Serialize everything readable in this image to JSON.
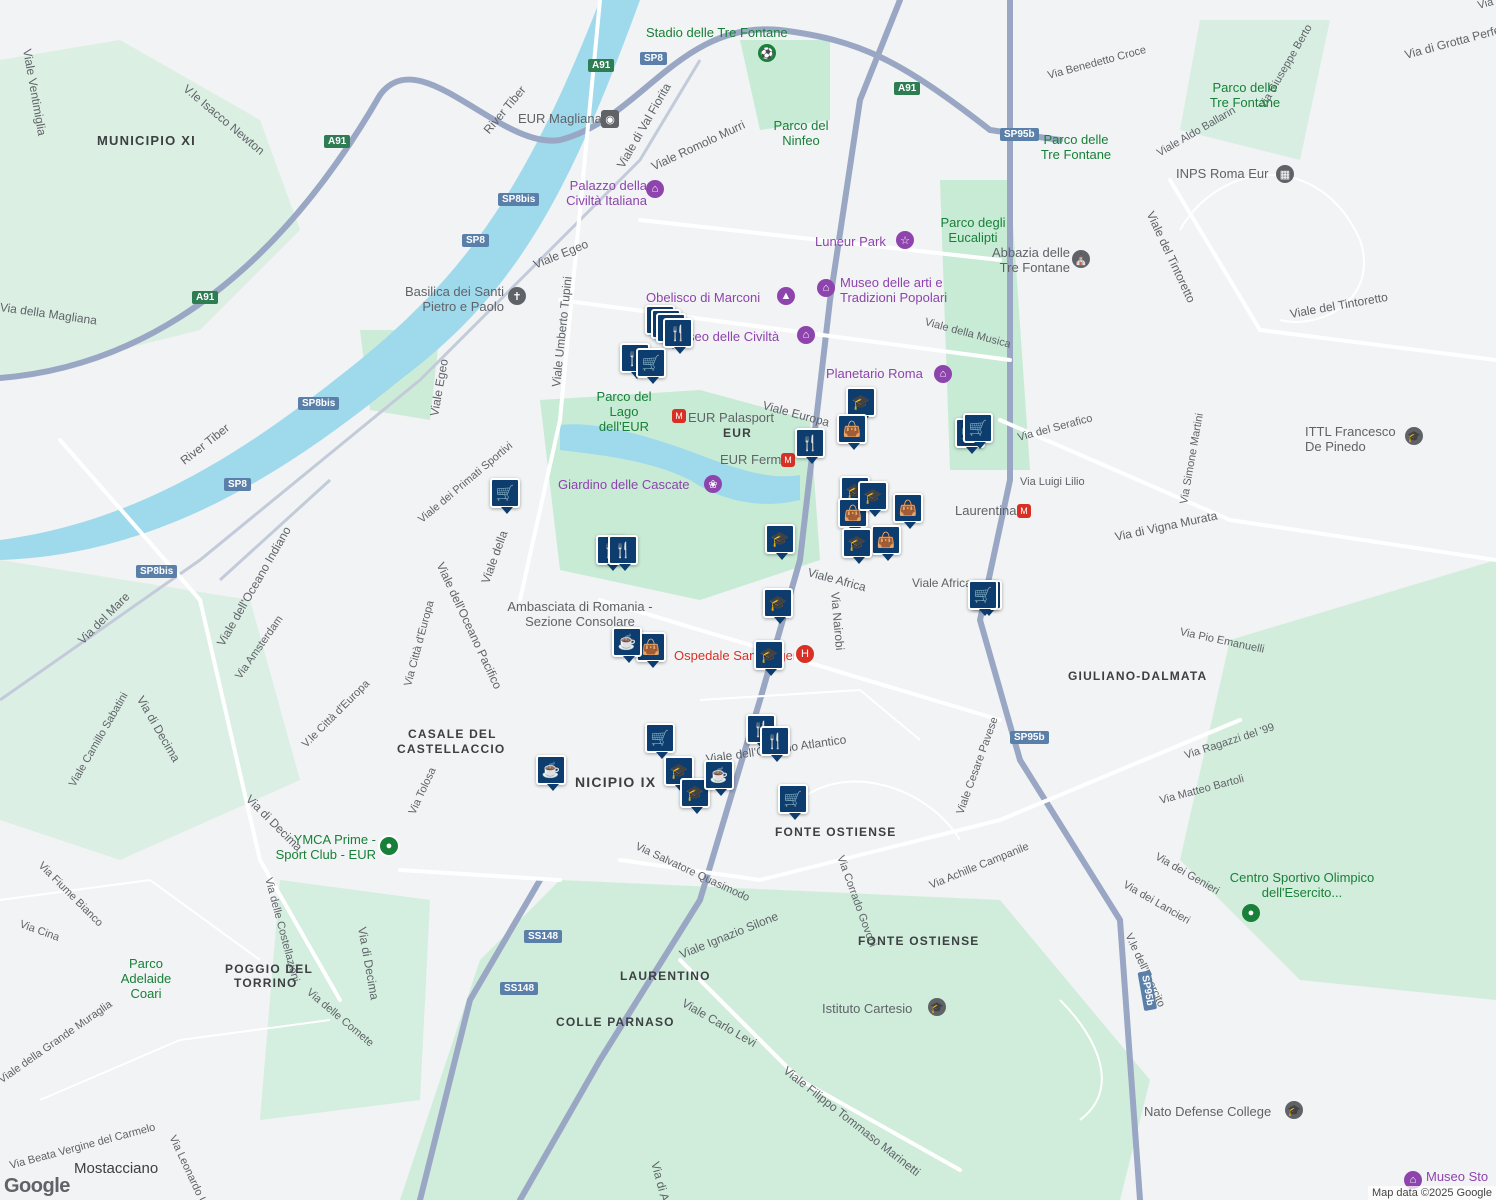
{
  "map": {
    "attribution": "Map data ©2025 Google",
    "logo": "Google",
    "colors": {
      "land": "#f1f3f4",
      "park": "#c8ebd5",
      "water": "#9fd9ec",
      "highway": "#9aa7c4",
      "road": "#ffffff",
      "pin": "#0d3d6e"
    }
  },
  "districts": [
    {
      "text": "MUNICIPIO XI"
    },
    {
      "text": "EUR"
    },
    {
      "text": "GIULIANO-DALMATA"
    },
    {
      "text": "CASALE DEL"
    },
    {
      "text": "CASTELLACCIO"
    },
    {
      "text": "NICIPIO IX"
    },
    {
      "text": "FONTE OSTIENSE"
    },
    {
      "text": "FONTE OSTIENSE"
    },
    {
      "text": "LAURENTINO"
    },
    {
      "text": "COLLE PARNASO"
    },
    {
      "text": "POGGIO DEL"
    },
    {
      "text": "TORRINO"
    },
    {
      "text": "Mostacciano"
    }
  ],
  "roads": [
    {
      "text": "Viale Ventimiglia"
    },
    {
      "text": "V.le Isacco Newton"
    },
    {
      "text": "Via della Magliana"
    },
    {
      "text": "Via del Mare"
    },
    {
      "text": "River Tiber"
    },
    {
      "text": "River Tiber"
    },
    {
      "text": "Viale Egeo"
    },
    {
      "text": "Viale Egeo"
    },
    {
      "text": "Viale Umberto Tupini"
    },
    {
      "text": "Viale di Val Fiorita"
    },
    {
      "text": "Viale Romolo Murri"
    },
    {
      "text": "Viale Europa"
    },
    {
      "text": "Viale Africa"
    },
    {
      "text": "Viale Africa"
    },
    {
      "text": "Via Nairobi"
    },
    {
      "text": "Viale dei Primati Sportivi"
    },
    {
      "text": "Viale dell'Oceano Indiano"
    },
    {
      "text": "Viale dell'Oceano Pacifico"
    },
    {
      "text": "Viale della"
    },
    {
      "text": "Via di Decima"
    },
    {
      "text": "Via di Decima"
    },
    {
      "text": "Via di Decima"
    },
    {
      "text": "Viale del Tintoretto"
    },
    {
      "text": "Viale del Tintoretto"
    },
    {
      "text": "Via di Vigna Murata"
    },
    {
      "text": "Via del Serafico"
    },
    {
      "text": "Via Luigi Lilio"
    },
    {
      "text": "Viale della Musica"
    },
    {
      "text": "Via Benedetto Croce"
    },
    {
      "text": "Via Giuseppe Berto"
    },
    {
      "text": "Viale Aldo Ballarin"
    },
    {
      "text": "Via di Grotta Perfetta"
    },
    {
      "text": "Via Pio Emanuelli"
    },
    {
      "text": "Via Ragazzi del '99"
    },
    {
      "text": "Via Matteo Bartoli"
    },
    {
      "text": "Via dei Genieri"
    },
    {
      "text": "Via dei Lancieri"
    },
    {
      "text": "V.le dell'Esercito"
    },
    {
      "text": "Viale Cesare Pavese"
    },
    {
      "text": "Via Achille Campanile"
    },
    {
      "text": "Via Corrado Govoni"
    },
    {
      "text": "Via Salvatore Quasimodo"
    },
    {
      "text": "Viale Ignazio Silone"
    },
    {
      "text": "Viale Carlo Levi"
    },
    {
      "text": "Viale Filippo Tommaso Marinetti"
    },
    {
      "text": "Via di Acilia"
    },
    {
      "text": "Via Cina"
    },
    {
      "text": "Via Fiume Bianco"
    },
    {
      "text": "Viale Camillo Sabatini"
    },
    {
      "text": "Via Amsterdam"
    },
    {
      "text": "Via Città d'Europa"
    },
    {
      "text": "V.le Città d'Europa"
    },
    {
      "text": "Via Tolosa"
    },
    {
      "text": "Via delle Costellazioni"
    },
    {
      "text": "Via delle Comete"
    },
    {
      "text": "Viale della Grande Muraglia"
    },
    {
      "text": "Via Beata Vergine del Carmelo"
    },
    {
      "text": "Via Leonardo Umile"
    },
    {
      "text": "Via Simone Martini"
    },
    {
      "text": "Via Greve"
    },
    {
      "text": "Viale dell'Oceano Atlantico"
    }
  ],
  "pois": [
    {
      "text": "Stadio delle Tre Fontane",
      "icon": "stadium-icon"
    },
    {
      "text": "EUR Magliana",
      "icon": "metro-icon"
    },
    {
      "text": "Palazzo della Civiltà Italiana",
      "icon": "museum-icon"
    },
    {
      "text": "Parco del Ninfeo",
      "icon": ""
    },
    {
      "text": "Luneur Park",
      "icon": "amusement-park-icon"
    },
    {
      "text": "Parco degli Eucalipti",
      "icon": ""
    },
    {
      "text": "Abbazia delle Tre Fontane",
      "icon": "church-icon"
    },
    {
      "text": "Parco delle Tre Fontane",
      "icon": ""
    },
    {
      "text": "Parco delle Tre Fontane",
      "icon": ""
    },
    {
      "text": "INPS Roma Eur",
      "icon": "building-icon"
    },
    {
      "text": "Museo delle arti e Tradizioni Popolari",
      "icon": "museum-icon"
    },
    {
      "text": "Obelisco di Marconi",
      "icon": "monument-icon"
    },
    {
      "text": "Museo delle Civiltà",
      "icon": "museum-icon"
    },
    {
      "text": "Planetario Roma",
      "icon": "museum-icon"
    },
    {
      "text": "Basilica dei Santi Pietro e Paolo",
      "icon": "church-icon"
    },
    {
      "text": "Parco del Lago dell'EUR",
      "icon": ""
    },
    {
      "text": "EUR Palasport",
      "icon": "metro-icon"
    },
    {
      "text": "EUR Fermi",
      "icon": "metro-icon"
    },
    {
      "text": "Giardino delle Cascate",
      "icon": "park-icon"
    },
    {
      "text": "Laurentina",
      "icon": "metro-icon"
    },
    {
      "text": "ITTL Francesco De Pinedo",
      "icon": "school-icon"
    },
    {
      "text": "Ambasciata di Romania - Sezione Consolare",
      "icon": ""
    },
    {
      "text": "Ospedale Sant'Eugenio",
      "icon": "hospital-icon"
    },
    {
      "text": "YMCA Prime - Sport Club - EUR",
      "icon": "sport-icon"
    },
    {
      "text": "Centro Sportivo Olimpico dell'Esercito...",
      "icon": "sport-icon"
    },
    {
      "text": "Parco Adelaide Coari",
      "icon": ""
    },
    {
      "text": "Istituto Cartesio",
      "icon": "school-icon"
    },
    {
      "text": "Nato Defense College",
      "icon": "school-icon"
    },
    {
      "text": "Museo Sto",
      "icon": "museum-icon"
    }
  ],
  "shields": [
    {
      "text": "A91"
    },
    {
      "text": "SP8"
    },
    {
      "text": "A91"
    },
    {
      "text": "SP95b"
    },
    {
      "text": "A91"
    },
    {
      "text": "SP8bis"
    },
    {
      "text": "SP8"
    },
    {
      "text": "A91"
    },
    {
      "text": "SP8bis"
    },
    {
      "text": "SP8"
    },
    {
      "text": "SP8bis"
    },
    {
      "text": "SP95b"
    },
    {
      "text": "SS148"
    },
    {
      "text": "SS148"
    },
    {
      "text": "SP95b"
    }
  ],
  "markers": [
    {
      "type": "cafe-icon"
    },
    {
      "type": "grocery-icon"
    },
    {
      "type": "grocery-icon"
    },
    {
      "type": "restaurant-icon"
    },
    {
      "type": "restaurant-icon"
    },
    {
      "type": "grocery-icon"
    },
    {
      "type": "school-icon"
    },
    {
      "type": "shopping-icon"
    },
    {
      "type": "restaurant-icon"
    },
    {
      "type": "grocery-icon"
    },
    {
      "type": "grocery-icon"
    },
    {
      "type": "school-icon"
    },
    {
      "type": "shopping-icon"
    },
    {
      "type": "school-icon"
    },
    {
      "type": "shopping-icon"
    },
    {
      "type": "shopping-icon"
    },
    {
      "type": "school-icon"
    },
    {
      "type": "restaurant-icon"
    },
    {
      "type": "school-icon"
    },
    {
      "type": "grocery-icon"
    },
    {
      "type": "cafe-icon"
    },
    {
      "type": "shopping-icon"
    },
    {
      "type": "school-icon"
    },
    {
      "type": "school-icon"
    },
    {
      "type": "cafe-icon"
    },
    {
      "type": "restaurant-icon"
    },
    {
      "type": "restaurant-icon"
    },
    {
      "type": "grocery-icon"
    },
    {
      "type": "cafe-icon"
    },
    {
      "type": "school-icon"
    },
    {
      "type": "school-icon"
    },
    {
      "type": "grocery-icon"
    },
    {
      "type": "cafe-icon"
    },
    {
      "type": "grocery-icon"
    },
    {
      "type": "restaurant-icon"
    }
  ],
  "icon_glyphs": {
    "cafe-icon": "☕",
    "grocery-icon": "🛒",
    "restaurant-icon": "🍴",
    "school-icon": "🎓",
    "shopping-icon": "👜"
  }
}
